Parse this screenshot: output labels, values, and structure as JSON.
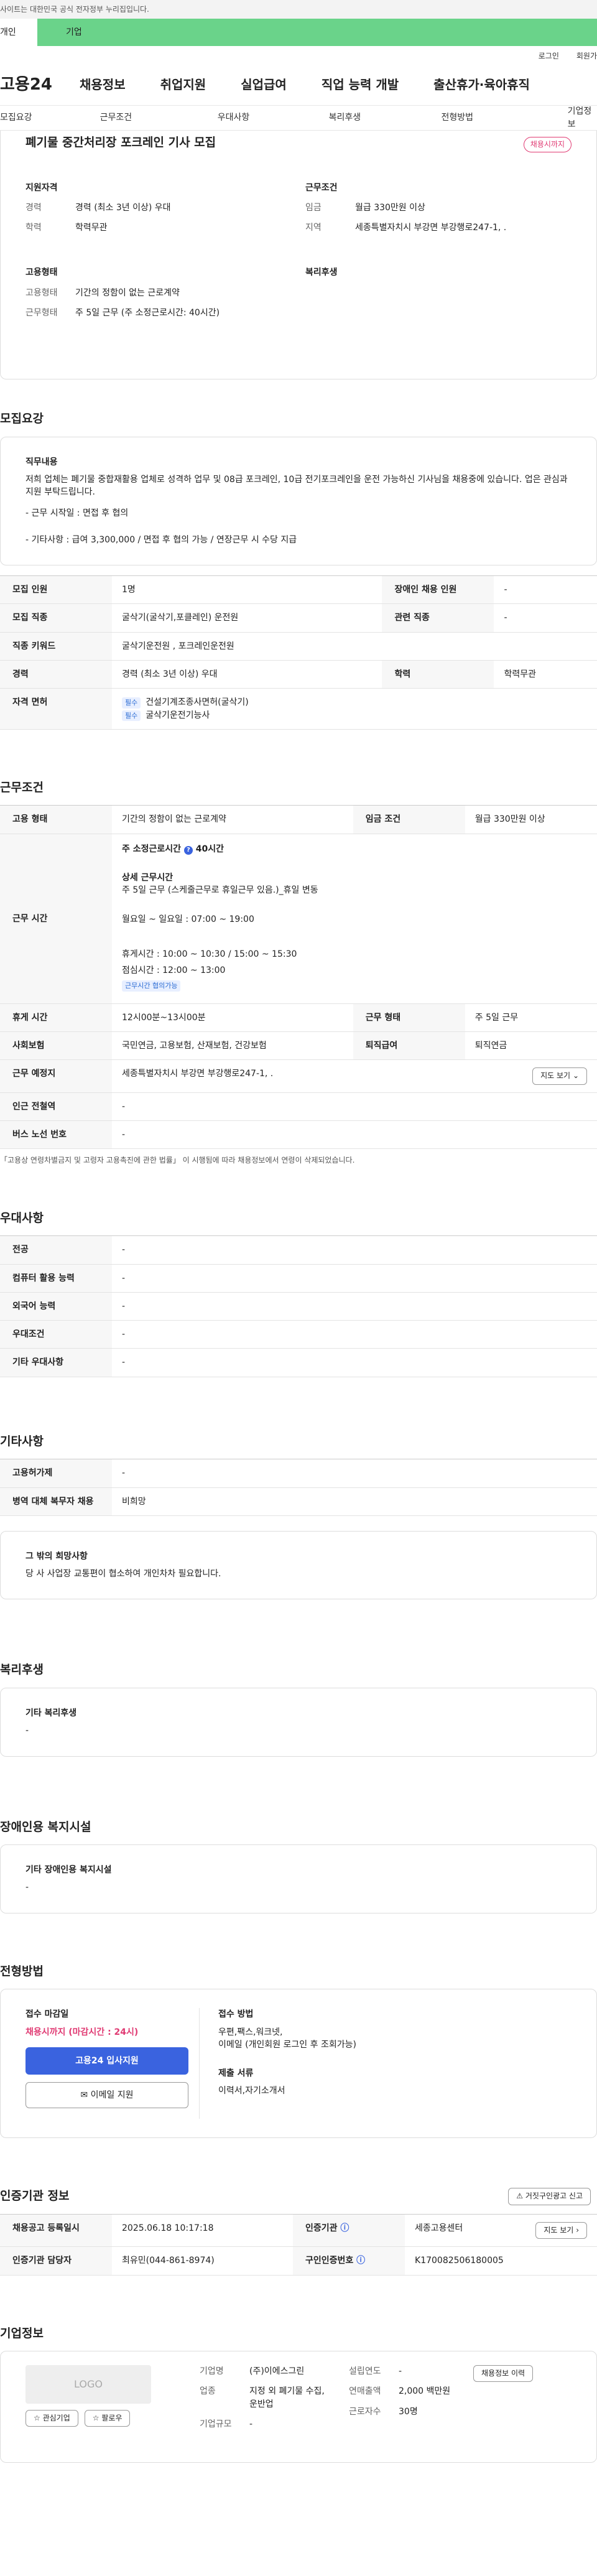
{
  "gov_banner": "사이트는 대한민국 공식 전자정부 누리집입니다.",
  "tabs": [
    "개인",
    "기업"
  ],
  "util": [
    "로그인",
    "회원가"
  ],
  "logo": "고용24",
  "gnb": [
    "채용정보",
    "취업지원",
    "실업급여",
    "직업 능력 개발",
    "출산휴가·육아휴직"
  ],
  "snb": [
    "모집요강",
    "근무조건",
    "우대사항",
    "복리후생",
    "전형방법",
    "기업정보"
  ],
  "title": "폐기물 중간처리장 포크레인 기사 모집",
  "status_badge": "채용시까지",
  "summary": {
    "qualification": {
      "heading": "지원자격",
      "rows": [
        {
          "k": "경력",
          "v": "경력 (최소 3년 이상) 우대"
        },
        {
          "k": "학력",
          "v": "학력무관"
        }
      ]
    },
    "conditions": {
      "heading": "근무조건",
      "rows": [
        {
          "k": "임금",
          "v": "월급 330만원 이상"
        },
        {
          "k": "지역",
          "v": "세종특별자치시 부강면 부강행로247-1, ."
        }
      ]
    },
    "employment": {
      "heading": "고용형태",
      "rows": [
        {
          "k": "고용형태",
          "v": "기간의 정함이 없는 근로계약"
        },
        {
          "k": "근무형태",
          "v": "주 5일 근무 (주 소정근로시간: 40시간)"
        }
      ]
    },
    "welfare": {
      "heading": "복리후생"
    }
  },
  "recruit": {
    "section": "모집요강",
    "duty_heading": "직무내용",
    "duty_text": "저희 업체는 폐기물 중합재활용 업체로 성격하 업무 및 08급 포크레인, 10급 전기포크레인을 운전 가능하신 기사님을 채용중에 있습니다. 업은 관심과 지원 부탁드립니다.",
    "duty_lines": [
      "- 근무 시작일 : 면접 후 협의",
      "- 기타사항 : 급여 3,300,000 / 면접 후 협의 가능 / 연장근무 시 수당 지급"
    ],
    "rows": [
      {
        "k1": "모집 인원",
        "v1": "1명",
        "k2": "장애인 채용 인원",
        "v2": "-"
      },
      {
        "k1": "모집 직종",
        "v1": "굴삭기(굴삭기,포클레인) 운전원",
        "k2": "관련 직종",
        "v2": "-"
      },
      {
        "k1": "직종 키워드",
        "v1": "굴삭기운전원 , 포크레인운전원"
      },
      {
        "k1": "경력",
        "v1": "경력 (최소 3년 이상) 우대",
        "k2": "학력",
        "v2": "학력무관"
      }
    ],
    "license_key": "자격 면허",
    "licenses": [
      {
        "tag": "필수",
        "name": "건설기계조종사면허(굴삭기)"
      },
      {
        "tag": "필수",
        "name": "굴삭기운전기능사"
      }
    ]
  },
  "work": {
    "section": "근무조건",
    "type_k": "고용 형태",
    "type_v": "기간의 정함이 없는 근로계약",
    "wage_k": "임금 조건",
    "wage_v": "월급 330만원 이상",
    "hours_k": "근무 시간",
    "hours_week": "주 소정근로시간",
    "hours_week_val": "40시간",
    "hours_detail_h": "상세 근무시간",
    "hours_lines": [
      "주 5일 근무 (스케줄근무로 휴일근무 있음.)_휴일 변동",
      "월요일 ~ 일요일 : 07:00 ~ 19:00",
      "휴게시간 : 10:00 ~ 10:30 / 15:00 ~ 15:30",
      "점심시간 : 12:00 ~ 13:00"
    ],
    "hours_tag": "근무시간 협의가능",
    "rows": [
      {
        "k1": "휴게 시간",
        "v1": "12시00분~13시00분",
        "k2": "근무 형태",
        "v2": "주 5일 근무"
      },
      {
        "k1": "사회보험",
        "v1": "국민연금, 고용보험, 산재보험, 건강보험",
        "k2": "퇴직급여",
        "v2": "퇴직연금"
      }
    ],
    "place_k": "근무 예정지",
    "place_v": "세종특별자치시 부강면 부강행로247-1, .",
    "map_btn": "지도 보기",
    "station_k": "인근 전철역",
    "station_v": "-",
    "bus_k": "버스 노선 번호",
    "bus_v": "-",
    "note": "「고용상 연령차별금지 및 고령자 고용촉진에 관한 법률」 이 시행됨에 따라 채용정보에서 연령이 삭제되었습니다."
  },
  "pref": {
    "section": "우대사항",
    "rows": [
      {
        "k": "전공",
        "v": "-"
      },
      {
        "k": "컴퓨터 활용 능력",
        "v": "-"
      },
      {
        "k": "외국어 능력",
        "v": "-"
      },
      {
        "k": "우대조건",
        "v": "-"
      },
      {
        "k": "기타 우대사항",
        "v": "-"
      }
    ]
  },
  "etc": {
    "section": "기타사항",
    "rows": [
      {
        "k": "고용허가제",
        "v": "-"
      },
      {
        "k": "병역 대체 복무자 채용",
        "v": "비희망"
      }
    ],
    "other_h": "그 밖의 희망사항",
    "other_v": "당 사 사업장 교통편이 협소하여 개인차차 필요합니다."
  },
  "welfare": {
    "section": "복리후생",
    "h": "기타 복리후생",
    "v": "-"
  },
  "disab": {
    "section": "장애인용 복지시설",
    "h": "기타 장애인용 복지시설",
    "v": "-"
  },
  "proc": {
    "section": "전형방법",
    "deadline_h": "접수 마감일",
    "deadline_v": "채용시까지 (마감시간 : 24시)",
    "apply_btn": "고용24 입사지원",
    "email_btn": "이메일 지원",
    "method_h": "접수 방법",
    "method_v1": "우편,팩스,워크넷,",
    "method_v2": "이메일 (개인회원 로그인 후 조회가능)",
    "docs_h": "제출 서류",
    "docs_v": "이력서,자기소개서"
  },
  "cert": {
    "section": "인증기관 정보",
    "report_btn": "거짓구인광고 신고",
    "rows": [
      {
        "k1": "채용공고 등록일시",
        "v1": "2025.06.18 10:17:18",
        "k2": "인증기관",
        "v2": "세종고용센터"
      },
      {
        "k1": "인증기관 담당자",
        "v1": "최유민(044-861-8974)",
        "k2": "구인인증번호",
        "v2": "K170082506180005"
      }
    ]
  },
  "company": {
    "section": "기업정보",
    "logo": "LOGO",
    "interest": "관심기업",
    "follow": "팔로우",
    "rows": [
      {
        "k": "기업명",
        "v": "(주)이에스그린"
      },
      {
        "k": "업종",
        "v": "지정 외 폐기물 수집, 운반업"
      },
      {
        "k": "기업규모",
        "v": "-"
      }
    ],
    "rows2": [
      {
        "k": "설립연도",
        "v": "-"
      },
      {
        "k": "연매출액",
        "v": "2,000 백만원"
      },
      {
        "k": "근로자수",
        "v": "30명"
      }
    ],
    "jobs_btn": "채용정보 이력"
  }
}
